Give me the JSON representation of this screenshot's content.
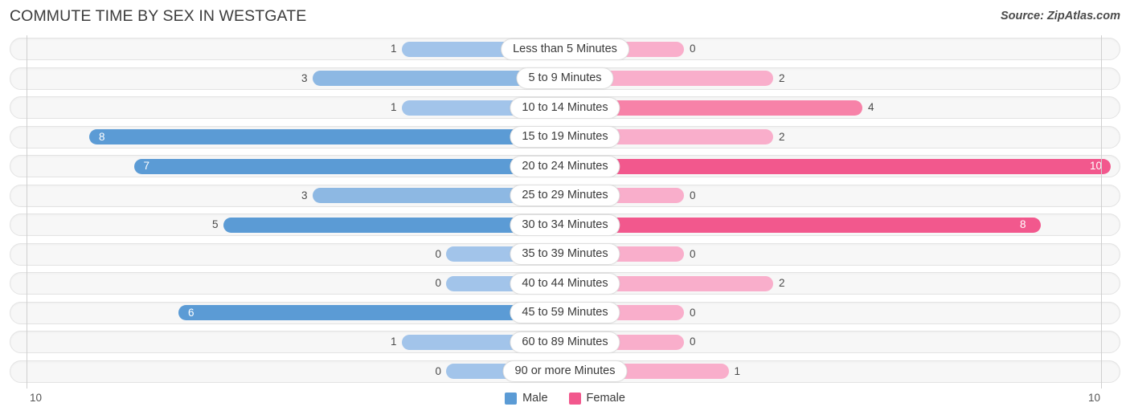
{
  "header": {
    "title": "COMMUTE TIME BY SEX IN WESTGATE",
    "source": "Source: ZipAtlas.com"
  },
  "legend": {
    "items": [
      {
        "label": "Male",
        "color": "#5b9bd5"
      },
      {
        "label": "Female",
        "color": "#f2588d"
      }
    ]
  },
  "axis": {
    "left_tick": "10",
    "right_tick": "10",
    "max": 10
  },
  "colors": {
    "male_light": "#a2c4ea",
    "male_mid": "#8db8e3",
    "male_dark": "#5b9bd5",
    "female_light": "#f9aecb",
    "female_mid": "#f782a8",
    "female_dark": "#f2588d",
    "track_bg": "#f7f7f7",
    "track_border": "#e3e3e3",
    "axis": "#cfcfcf",
    "text": "#3c3c3c"
  },
  "chart_data": {
    "type": "bar",
    "orientation": "horizontal-diverging",
    "title": "COMMUTE TIME BY SEX IN WESTGATE",
    "xlabel": "",
    "ylabel": "",
    "xlim": [
      10,
      10
    ],
    "grid": false,
    "legend_position": "bottom-center",
    "categories": [
      "Less than 5 Minutes",
      "5 to 9 Minutes",
      "10 to 14 Minutes",
      "15 to 19 Minutes",
      "20 to 24 Minutes",
      "25 to 29 Minutes",
      "30 to 34 Minutes",
      "35 to 39 Minutes",
      "40 to 44 Minutes",
      "45 to 59 Minutes",
      "60 to 89 Minutes",
      "90 or more Minutes"
    ],
    "series": [
      {
        "name": "Male",
        "values": [
          1,
          3,
          1,
          8,
          7,
          3,
          5,
          0,
          0,
          6,
          1,
          0
        ]
      },
      {
        "name": "Female",
        "values": [
          0,
          2,
          4,
          2,
          10,
          0,
          8,
          0,
          2,
          0,
          0,
          1
        ]
      }
    ]
  },
  "rows": [
    {
      "category": "Less than 5 Minutes",
      "male": "1",
      "female": "0"
    },
    {
      "category": "5 to 9 Minutes",
      "male": "3",
      "female": "2"
    },
    {
      "category": "10 to 14 Minutes",
      "male": "1",
      "female": "4"
    },
    {
      "category": "15 to 19 Minutes",
      "male": "8",
      "female": "2"
    },
    {
      "category": "20 to 24 Minutes",
      "male": "7",
      "female": "10"
    },
    {
      "category": "25 to 29 Minutes",
      "male": "3",
      "female": "0"
    },
    {
      "category": "30 to 34 Minutes",
      "male": "5",
      "female": "8"
    },
    {
      "category": "35 to 39 Minutes",
      "male": "0",
      "female": "0"
    },
    {
      "category": "40 to 44 Minutes",
      "male": "0",
      "female": "2"
    },
    {
      "category": "45 to 59 Minutes",
      "male": "6",
      "female": "0"
    },
    {
      "category": "60 to 89 Minutes",
      "male": "1",
      "female": "0"
    },
    {
      "category": "90 or more Minutes",
      "male": "0",
      "female": "1"
    }
  ]
}
